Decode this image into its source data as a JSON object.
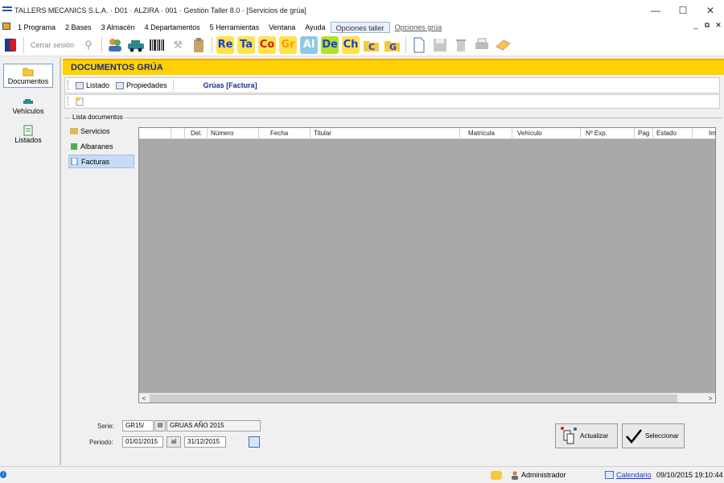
{
  "window": {
    "title": "TALLERS MECANICS S.L.A. · D01 · ALZIRA · 001 · Gestión Taller 8.0 · [Servicios de grúa]"
  },
  "menu": {
    "items": [
      "1 Programa",
      "2 Bases",
      "3 Almacén",
      "4 Departamentos",
      "5 Herramientas",
      "Ventana",
      "Ayuda"
    ],
    "opciones_taller": "Opciones taller",
    "opciones_grua": "Opciones grúa"
  },
  "toolbar": {
    "cerrar_sesion": "Cerrar sesión",
    "letters": [
      {
        "t": "Re",
        "color": "#1a3fd6",
        "bg": "#ffe34d"
      },
      {
        "t": "Ta",
        "color": "#1a3fd6",
        "bg": "#ffe34d"
      },
      {
        "t": "Co",
        "color": "#d61a1a",
        "bg": "#ffe34d"
      },
      {
        "t": "Gr",
        "color": "#ff9900",
        "bg": "#ffe34d"
      },
      {
        "t": "Al",
        "color": "#ffffff",
        "bg": "#8fc9e8"
      },
      {
        "t": "De",
        "color": "#1a3fd6",
        "bg": "#b5e02a"
      },
      {
        "t": "Ch",
        "color": "#1a3fd6",
        "bg": "#ffe34d"
      }
    ]
  },
  "leftnav": {
    "items": [
      {
        "label": "Documentos",
        "icon": "folder-icon"
      },
      {
        "label": "Vehículos",
        "icon": "car-icon"
      },
      {
        "label": "Listados",
        "icon": "list-icon"
      }
    ]
  },
  "main": {
    "header": "DOCUMENTOS GRÚA",
    "listado": "Listado",
    "propiedades": "Propiedades",
    "doc_label": "Grúas [Factura]",
    "group_label": "Lista documentos",
    "doc_types": [
      "Servicios",
      "Albaranes",
      "Facturas"
    ],
    "columns": [
      "",
      "",
      "Del.",
      "Número",
      "Fecha",
      "Titular",
      "Matrícula",
      "Vehículo",
      "Nº Exp.",
      "Pag",
      "Estado",
      "Im"
    ]
  },
  "form": {
    "serie_label": "Serie:",
    "serie_value": "GR15/",
    "serie_desc": "GRUAS AÑO 2015",
    "periodo_label": "Periodo:",
    "periodo_from": "01/01/2015",
    "al_label": "al",
    "periodo_to": "31/12/2015",
    "actualizar": "Actualizar",
    "seleccionar": "Seleccionar"
  },
  "status": {
    "user": "Administrador",
    "calendar": "Calendario",
    "datetime": "09/10/2015 19:10:44"
  }
}
